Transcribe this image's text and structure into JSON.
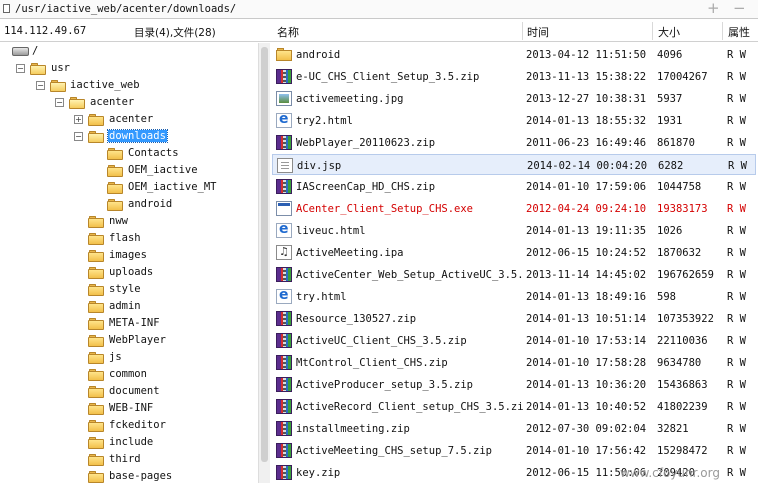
{
  "path_bar": {
    "path": "/usr/iactive_web/acenter/downloads/",
    "add_symbol": "+",
    "remove_symbol": "−",
    "icon": "file-icon"
  },
  "left_panel": {
    "server_ip": "114.112.49.67",
    "summary": "目录(4),文件(28)"
  },
  "tree": {
    "root": "/",
    "usr": "usr",
    "iactive_web": "iactive_web",
    "acenter": "acenter",
    "acenter_child": "acenter",
    "downloads": "downloads",
    "contacts": "Contacts",
    "oem_iactive": "OEM_iactive",
    "oem_iactive_mt": "OEM_iactive_MT",
    "android": "android",
    "nww": "nww",
    "flash": "flash",
    "images": "images",
    "uploads": "uploads",
    "style": "style",
    "admin": "admin",
    "meta_inf": "META-INF",
    "webplayer": "WebPlayer",
    "js": "js",
    "common": "common",
    "document": "document",
    "web_inf": "WEB-INF",
    "fckeditor": "fckeditor",
    "include": "include",
    "third": "third",
    "base_pages": "base-pages",
    "expand_symbol": "+",
    "collapse_symbol": "−"
  },
  "columns": {
    "name": "名称",
    "time": "时间",
    "size": "大小",
    "attr": "属性"
  },
  "files": [
    {
      "name": "android",
      "time": "2013-04-12 11:51:50",
      "size": "4096",
      "attr": "R W",
      "icon": "folder"
    },
    {
      "name": "e-UC_CHS_Client_Setup_3.5.zip",
      "time": "2013-11-13 15:38:22",
      "size": "17004267",
      "attr": "R W",
      "icon": "zip"
    },
    {
      "name": "activemeeting.jpg",
      "time": "2013-12-27 10:38:31",
      "size": "5937",
      "attr": "R W",
      "icon": "image"
    },
    {
      "name": "try2.html",
      "time": "2014-01-13 18:55:32",
      "size": "1931",
      "attr": "R W",
      "icon": "html"
    },
    {
      "name": "WebPlayer_20110623.zip",
      "time": "2011-06-23 16:49:46",
      "size": "861870",
      "attr": "R W",
      "icon": "zip"
    },
    {
      "name": "div.jsp",
      "time": "2014-02-14 00:04:20",
      "size": "6282",
      "attr": "R W",
      "icon": "document"
    },
    {
      "name": "IAScreenCap_HD_CHS.zip",
      "time": "2014-01-10 17:59:06",
      "size": "1044758",
      "attr": "R W",
      "icon": "zip"
    },
    {
      "name": "ACenter_Client_Setup_CHS.exe",
      "time": "2012-04-24 09:24:10",
      "size": "19383173",
      "attr": "R W",
      "icon": "exe"
    },
    {
      "name": "liveuc.html",
      "time": "2014-01-13 19:11:35",
      "size": "1026",
      "attr": "R W",
      "icon": "html"
    },
    {
      "name": "ActiveMeeting.ipa",
      "time": "2012-06-15 10:24:52",
      "size": "1870632",
      "attr": "R W",
      "icon": "audio"
    },
    {
      "name": "ActiveCenter_Web_Setup_ActiveUC_3.5...",
      "time": "2013-11-14 14:45:02",
      "size": "196762659",
      "attr": "R W",
      "icon": "zip"
    },
    {
      "name": "try.html",
      "time": "2014-01-13 18:49:16",
      "size": "598",
      "attr": "R W",
      "icon": "html"
    },
    {
      "name": "Resource_130527.zip",
      "time": "2014-01-13 10:51:14",
      "size": "107353922",
      "attr": "R W",
      "icon": "zip"
    },
    {
      "name": "ActiveUC_Client_CHS_3.5.zip",
      "time": "2014-01-10 17:53:14",
      "size": "22110036",
      "attr": "R W",
      "icon": "zip"
    },
    {
      "name": "MtControl_Client_CHS.zip",
      "time": "2014-01-10 17:58:28",
      "size": "9634780",
      "attr": "R W",
      "icon": "zip"
    },
    {
      "name": "ActiveProducer_setup_3.5.zip",
      "time": "2014-01-13 10:36:20",
      "size": "15436863",
      "attr": "R W",
      "icon": "zip"
    },
    {
      "name": "ActiveRecord_Client_setup_CHS_3.5.zip",
      "time": "2014-01-13 10:40:52",
      "size": "41802239",
      "attr": "R W",
      "icon": "zip"
    },
    {
      "name": "installmeeting.zip",
      "time": "2012-07-30 09:02:04",
      "size": "32821",
      "attr": "R W",
      "icon": "zip"
    },
    {
      "name": "ActiveMeeting_CHS_setup_7.5.zip",
      "time": "2014-01-10 17:56:42",
      "size": "15298472",
      "attr": "R W",
      "icon": "zip"
    },
    {
      "name": "key.zip",
      "time": "2012-06-15 11:50:06",
      "size": "209420",
      "attr": "R W",
      "icon": "zip"
    }
  ],
  "selected_file": "div.jsp",
  "highlight_color": "#d40000",
  "selection_color": "#3399ff",
  "watermark": "www.cfoyunr.org"
}
